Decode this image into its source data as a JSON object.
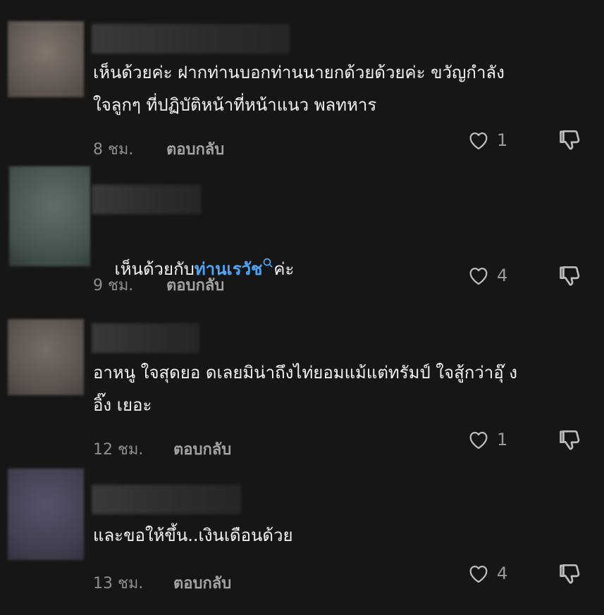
{
  "comments": [
    {
      "avatar_color": "#7a6e66",
      "text_parts": [
        "เห็นด้วยค่ะ ฝากท่านบอกท่านนายกด้วยด้วยค่ะ ขวัญกำลัง\nใจลูกๆ ที่ปฏิบัติหน้าที่หน้าแนว พลทหาร"
      ],
      "time": "8 ชม.",
      "reply_label": "ตอบกลับ",
      "likes": "1"
    },
    {
      "avatar_color": "#55655c",
      "text_before": "เห็นด้วยกับ",
      "mention": "ท่านเรวัช",
      "text_after": "ค่ะ",
      "time": "9 ชม.",
      "reply_label": "ตอบกลับ",
      "likes": "4"
    },
    {
      "avatar_color": "#6a625c",
      "text_parts": [
        "อาหนู ใจสุดยอ ดเลยมิน่าถึงไท่ยอมแม้แต่ทรัมป์ ใจสู้กว่าอุ๊ ง\nอิ๊ง เยอะ"
      ],
      "time": "12 ชม.",
      "reply_label": "ตอบกลับ",
      "likes": "1"
    },
    {
      "avatar_color": "#4c4b58",
      "text_parts": [
        "และขอให้ขึ้น..เงินเดือนด้วย"
      ],
      "time": "13 ชม.",
      "reply_label": "ตอบกลับ",
      "likes": "4"
    }
  ],
  "icons": {
    "like": "heart-outline-icon",
    "dislike": "thumbs-down-outline-icon",
    "mention_search": "search-icon"
  },
  "colors": {
    "background": "#161616",
    "mention": "#4ea6f5",
    "meta": "#8e8e8e"
  }
}
